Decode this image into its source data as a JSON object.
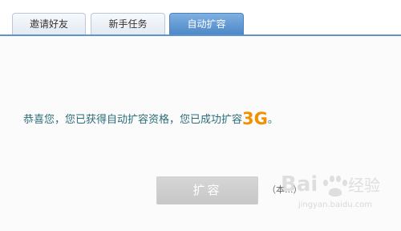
{
  "tabs": [
    {
      "label": "邀请好友",
      "active": false
    },
    {
      "label": "新手任务",
      "active": false
    },
    {
      "label": "自动扩容",
      "active": true
    }
  ],
  "main": {
    "message_text": "恭喜您，您已获得自动扩容资格，您已成功扩容",
    "amount": "3G",
    "message_suffix": "。",
    "button_label": "扩容",
    "button_disabled": true,
    "note": "（本...）"
  },
  "watermark": {
    "text": "Baidu 经验",
    "url_text": "jingyan.baidu.com"
  },
  "colors": {
    "accent": "#5e93cc",
    "message": "#2b6d78",
    "amount": "#f29100",
    "button_disabled": "#cccccc"
  }
}
